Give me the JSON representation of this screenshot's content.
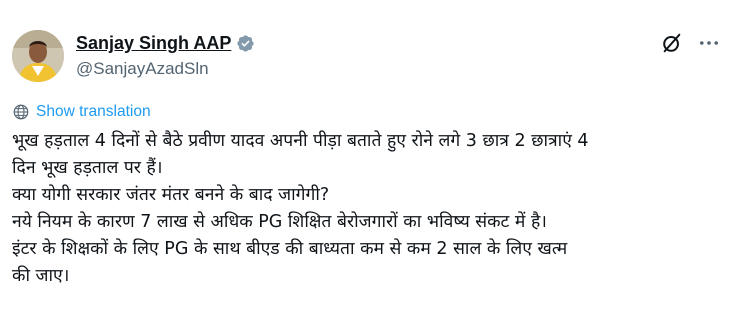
{
  "author": {
    "display_name": "Sanjay Singh AAP",
    "handle": "@SanjayAzadSln",
    "verified": true,
    "avatar_icon": "profile-photo"
  },
  "actions": {
    "grok_icon": "grok-slash-circle-icon",
    "more_icon": "more-dots-icon"
  },
  "translation": {
    "icon": "translate-globe-icon",
    "label": "Show translation"
  },
  "tweet": {
    "lines": [
      "भूख हड़ताल 4 दिनों से बैठे प्रवीण यादव अपनी पीड़ा बताते हुए रोने लगे 3 छात्र 2 छात्राएं 4",
      "दिन भूख हड़ताल पर हैं।",
      "क्या योगी सरकार जंतर मंतर बनने के बाद जागेगी?",
      "नये नियम के कारण 7 लाख से अधिक PG शिक्षित बेरोजगारों का भविष्य संकट में है।",
      "इंटर के शिक्षकों के लिए PG के साथ बीएड की बाध्यता कम से कम 2 साल के लिए खत्म",
      "की जाए।"
    ]
  },
  "colors": {
    "text": "#0f1419",
    "secondary": "#536471",
    "link": "#1d9bf0",
    "verified_badge": "#829aab"
  }
}
